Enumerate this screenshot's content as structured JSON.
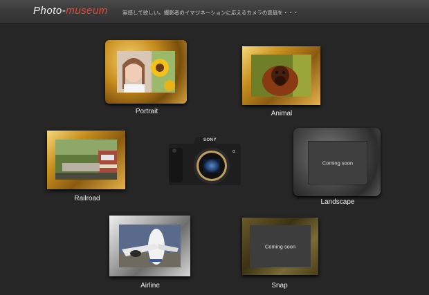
{
  "header": {
    "logo_left": "Photo-",
    "logo_right": "museum",
    "tagline": "実感して欲しい。撮影者のイマジネーションに応えるカメラの真価を・・・"
  },
  "frames": {
    "portrait": {
      "label": "Portrait"
    },
    "animal": {
      "label": "Animal"
    },
    "railroad": {
      "label": "Railroad"
    },
    "landscape": {
      "label": "Landscape",
      "status": "Coming soon"
    },
    "airline": {
      "label": "Airline"
    },
    "snap": {
      "label": "Snap",
      "status": "Coming soon"
    }
  },
  "camera": {
    "brand": "SONY",
    "badge": "α"
  },
  "colors": {
    "accent": "#e0483b",
    "background": "#262626"
  }
}
